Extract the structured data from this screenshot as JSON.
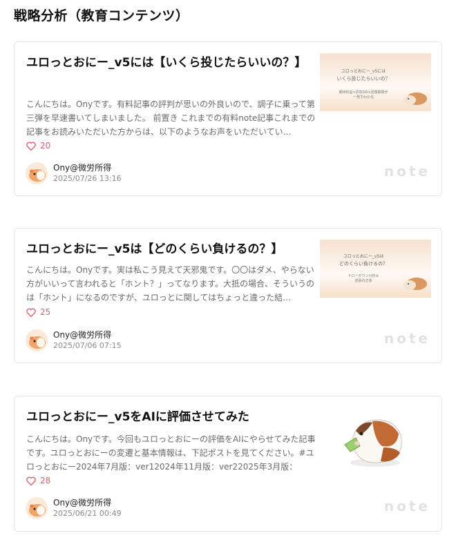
{
  "page": {
    "title": "戦略分析（教育コンテンツ）"
  },
  "articles": [
    {
      "title": "ユロっとおにー_v5には【いくら投じたらいいの？】",
      "excerpt": "こんにちは。Onyです。有料記事の評判が思いの外良いので、調子に乗って第三弾を早速書いてしまいました。 前置き これまでの有料note記事これまでの記事をお読みいただいた方からは、以下のようなお声をいただいてい…",
      "likes": "20",
      "author": "Ony@微労所得",
      "date": "2025/07/26 13:16",
      "thumb_title_small": "ユロっとおにー_v5には",
      "thumb_title": "いくら投じたらいいの？",
      "thumb_sub_1": "期待利益×許容DD×回復期間が",
      "thumb_sub_2": "一発でわかる",
      "logo": "note"
    },
    {
      "title": "ユロっとおにー_v5は【どのくらい負けるの？】",
      "excerpt": "こんにちは。Onyです。実は私こう見えて天邪鬼です。〇〇はダメ、やらない方がいいって言われると「ホント？」ってなります。大抵の場合、そういうのは「ホント」になるのですが、ユロっとに関してはちょっと違った結…",
      "likes": "25",
      "author": "Ony@微労所得",
      "date": "2025/07/06 07:15",
      "thumb_title_small": "ユロっとおにー_v5は",
      "thumb_title": "どのくらい負けるの？",
      "thumb_sub_1": "ドローダウン分析＆",
      "thumb_sub_2": "逆張の正体",
      "logo": "note"
    },
    {
      "title": "ユロっとおにー_v5をAIに評価させてみた",
      "excerpt": "こんにちは。Onyです。今回もユロっとおにーの評価をAIにやらせてみた記事です。ユロっとおにーの変遷と基本情報は、下記ポストを見てください。#ユロっとおにー2024年7月版：ver12024年11月版：ver22025年3月版：ver…",
      "likes": "28",
      "author": "Ony@微労所得",
      "date": "2025/06/21 00:49",
      "logo": "note"
    }
  ],
  "colors": {
    "like": "#e25b6b",
    "border": "#e3e5e8",
    "excerpt": "#6a6a6a"
  },
  "icons": {
    "like": "heart-icon",
    "avatar": "guinea-pig-avatar",
    "logo": "note-logo"
  }
}
